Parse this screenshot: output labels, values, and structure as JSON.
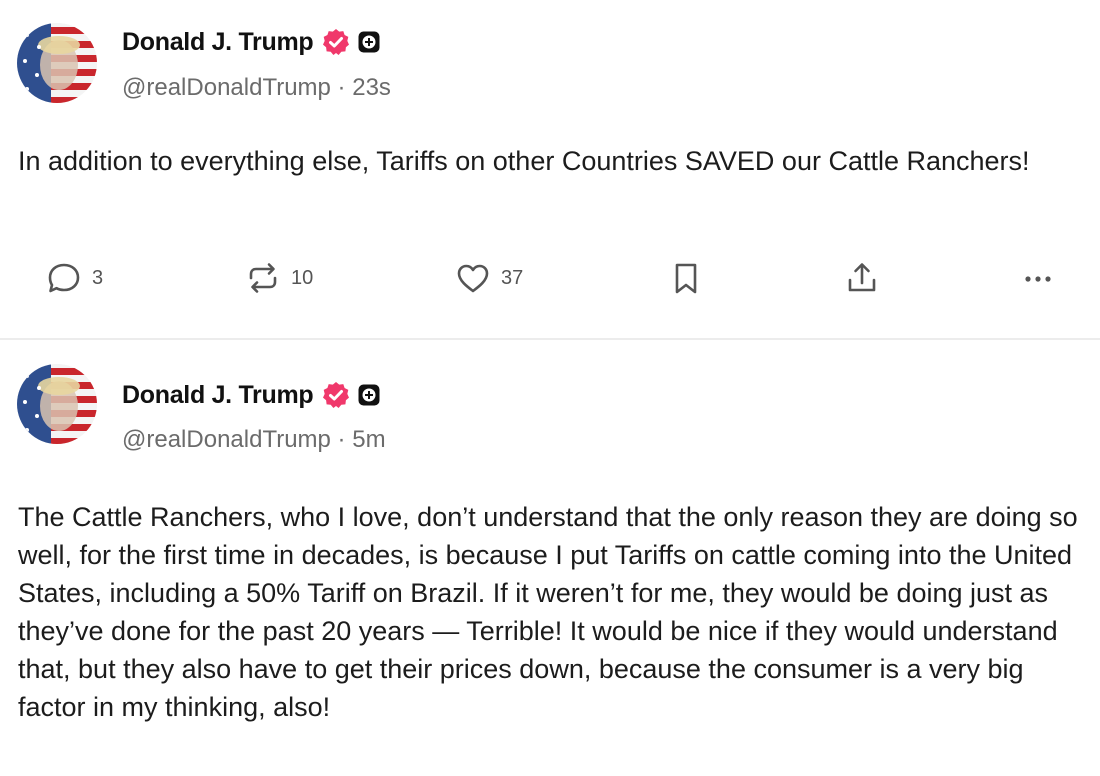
{
  "posts": [
    {
      "author": {
        "display_name": "Donald J. Trump",
        "handle": "@realDonaldTrump",
        "time_ago": "23s",
        "verified_color": "#f0386b"
      },
      "text": "In addition to everything else, Tariffs on other Countries SAVED our Cattle Ranchers!",
      "actions": {
        "reply_count": "3",
        "retruth_count": "10",
        "like_count": "37"
      }
    },
    {
      "author": {
        "display_name": "Donald J. Trump",
        "handle": "@realDonaldTrump",
        "time_ago": "5m",
        "verified_color": "#f0386b"
      },
      "text": "The Cattle Ranchers, who I love, don’t understand that the only reason they are doing so well, for the first time in decades, is because I put Tariffs on cattle coming into the United States, including a 50% Tariff on Brazil. If it weren’t for me, they would be doing just as they’ve done for the past 20 years — Terrible! It would be nice if they would understand that, but they also have to get their prices down, because the consumer is a very big factor in my thinking, also!"
    }
  ],
  "separator": " · ",
  "icons": {
    "reply": "reply-icon",
    "retruth": "retruth-icon",
    "like": "heart-icon",
    "bookmark": "bookmark-icon",
    "share": "share-icon",
    "more": "more-icon",
    "verified": "verified-badge-icon",
    "plus": "plus-badge-icon"
  },
  "colors": {
    "text": "#1c1c1c",
    "muted": "#6b6b6b",
    "verified": "#f0386b"
  }
}
